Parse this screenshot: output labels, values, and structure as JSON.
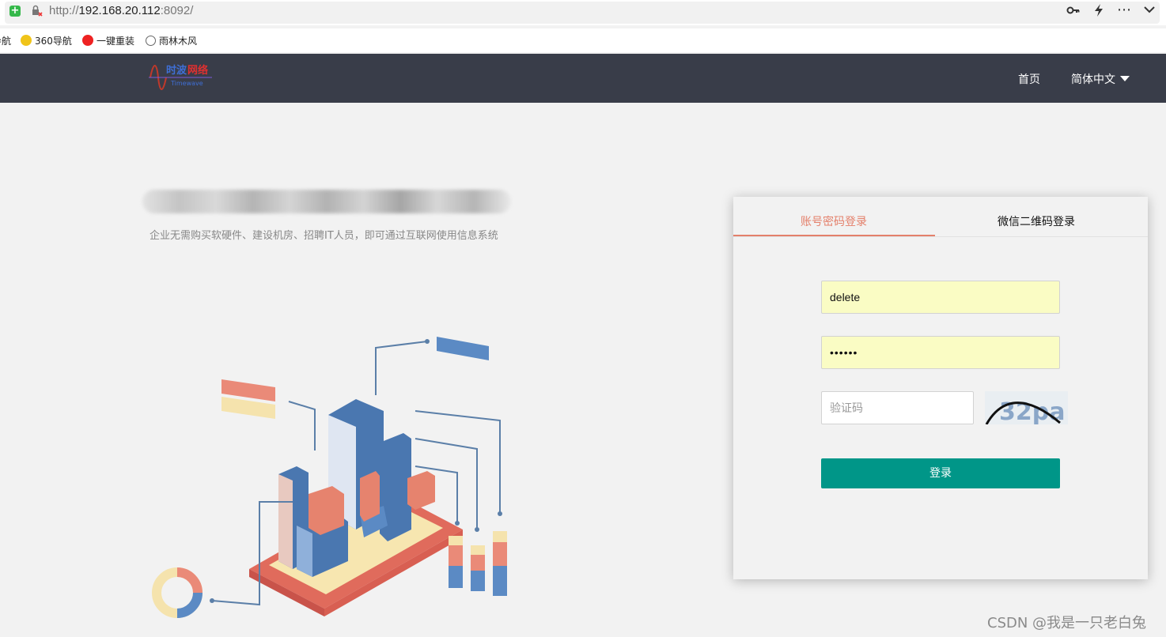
{
  "browser": {
    "url_prefix": "http://",
    "url_host": "192.168.20.112",
    "url_suffix": ":8092/",
    "bookmarks": [
      {
        "label": "导航",
        "icon": "none"
      },
      {
        "label": "360导航",
        "icon": "360-icon"
      },
      {
        "label": "一键重装",
        "icon": "tomato-icon"
      },
      {
        "label": "雨林木风",
        "icon": "globe-icon"
      }
    ]
  },
  "header": {
    "logo_text": "时波网络",
    "logo_subtext": "Timewave",
    "nav_home": "首页",
    "nav_lang": "简体中文"
  },
  "hero": {
    "subtitle": "企业无需购买软硬件、建设机房、招聘IT人员，即可通过互联网使用信息系统"
  },
  "login": {
    "tab_account": "账号密码登录",
    "tab_wechat": "微信二维码登录",
    "username_value": "delete",
    "password_mask": "••••••",
    "captcha_placeholder": "验证码",
    "captcha_text": "32pa",
    "submit_label": "登录"
  },
  "watermark": "CSDN @我是一只老白兔",
  "colors": {
    "navbar": "#393d49",
    "accent_tab": "#e4806b",
    "button": "#009688",
    "autofill": "#fafcc4"
  }
}
